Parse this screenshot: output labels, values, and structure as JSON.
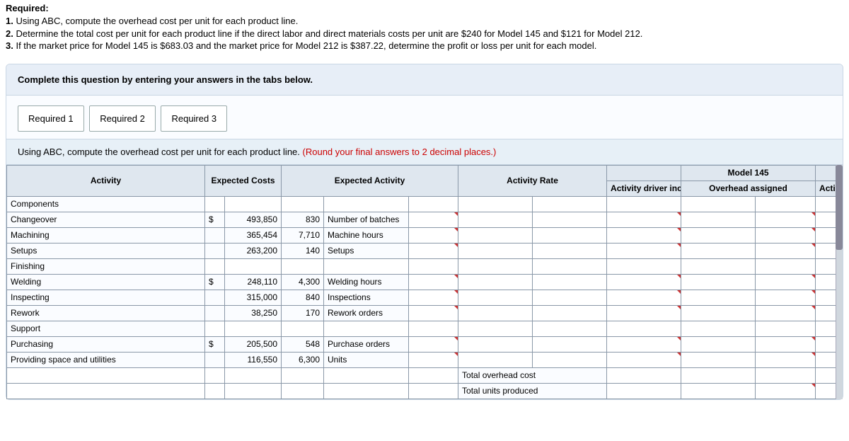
{
  "heading": "Required:",
  "intro_lines": [
    "1. Using ABC, compute the overhead cost per unit for each product line.",
    "2. Determine the total cost per unit for each product line if the direct labor and direct materials costs per unit are $240 for Model 145 and $121 for Model 212.",
    "3. If the market price for Model 145 is $683.03 and the market price for Model 212 is $387.22, determine the profit or loss per unit for each model."
  ],
  "instruction_bar": "Complete this question by entering your answers in the tabs below.",
  "tabs": [
    "Required 1",
    "Required 2",
    "Required 3"
  ],
  "sub_instruction": "Using ABC, compute the overhead cost per unit for each product line. ",
  "sub_instruction_red": "(Round your final answers to 2 decimal places.)",
  "headers": {
    "activity": "Activity",
    "expected_costs": "Expected Costs",
    "expected_activity": "Expected Activity",
    "activity_rate": "Activity Rate",
    "model145": "Model 145",
    "driver_incurred": "Activity driver incurred",
    "overhead_assigned": "Overhead assigned",
    "driver_incurred2": "Activity driver incurred"
  },
  "groups": [
    {
      "title": "Components",
      "rows": [
        {
          "name": "Changeover",
          "dollar": "$",
          "cost": "493,850",
          "qty": "830",
          "unit": "Number of batches"
        },
        {
          "name": "Machining",
          "dollar": "",
          "cost": "365,454",
          "qty": "7,710",
          "unit": "Machine hours"
        },
        {
          "name": "Setups",
          "dollar": "",
          "cost": "263,200",
          "qty": "140",
          "unit": "Setups"
        }
      ]
    },
    {
      "title": "Finishing",
      "rows": [
        {
          "name": "Welding",
          "dollar": "$",
          "cost": "248,110",
          "qty": "4,300",
          "unit": "Welding hours"
        },
        {
          "name": "Inspecting",
          "dollar": "",
          "cost": "315,000",
          "qty": "840",
          "unit": "Inspections"
        },
        {
          "name": "Rework",
          "dollar": "",
          "cost": "38,250",
          "qty": "170",
          "unit": "Rework orders"
        }
      ]
    },
    {
      "title": "Support",
      "rows": [
        {
          "name": "Purchasing",
          "dollar": "$",
          "cost": "205,500",
          "qty": "548",
          "unit": "Purchase orders"
        },
        {
          "name": "Providing space and utilities",
          "dollar": "",
          "cost": "116,550",
          "qty": "6,300",
          "unit": "Units"
        }
      ]
    }
  ],
  "totals": {
    "total_overhead": "Total overhead cost",
    "total_units": "Total units produced"
  }
}
